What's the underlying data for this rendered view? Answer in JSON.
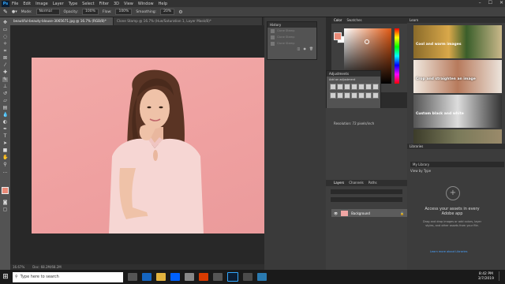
{
  "menubar": {
    "app_icon": "Ps",
    "items": [
      "File",
      "Edit",
      "Image",
      "Layer",
      "Type",
      "Select",
      "Filter",
      "3D",
      "View",
      "Window",
      "Help"
    ]
  },
  "options": {
    "mode_label": "Mode:",
    "mode_value": "Normal",
    "opacity_label": "Opacity:",
    "opacity_value": "100%",
    "flow_label": "Flow:",
    "flow_value": "100%",
    "smoothing_label": "Smoothing:",
    "smoothing_value": "20%"
  },
  "tabs": [
    {
      "label": "beautiful-beauty-blouse-3065671.jpg @ 16.7% (RGB/8)*"
    },
    {
      "label": "Clone Stamp @ 16.7% (Hue/Saturation 1, Layer Mask/8)*"
    }
  ],
  "status": {
    "zoom": "16.67%",
    "doc": "Doc: 68.2M/68.2M"
  },
  "history": {
    "title": "History",
    "rows": [
      "Clone Stamp",
      "Clone Stamp",
      "Clone Stamp"
    ]
  },
  "adjustments": {
    "title": "Adjustments",
    "subtitle": "Add an adjustment"
  },
  "color": {
    "tab1": "Color",
    "tab2": "Swatches",
    "fg": "#e98a77",
    "bg": "#ffffff"
  },
  "properties": {
    "resolution": "Resolution: 72 pixels/inch"
  },
  "layers": {
    "tab1": "Layers",
    "tab2": "Channels",
    "tab3": "Paths",
    "layer_name": "Background"
  },
  "learn": {
    "title": "Learn",
    "cards": [
      "Cool and warm images",
      "Crop and straighten an image",
      "Custom black and white"
    ]
  },
  "libraries": {
    "title": "Libraries",
    "library": "My Library",
    "view_by": "View by Type",
    "headline": "Access your assets in every Adobe app",
    "body": "Drag and drop images or add colors, layer styles, and other assets from your file.",
    "link": "Learn more about Libraries"
  },
  "taskbar": {
    "search": "Type here to search",
    "time": "8:42 PM",
    "date": "3/7/2019"
  }
}
